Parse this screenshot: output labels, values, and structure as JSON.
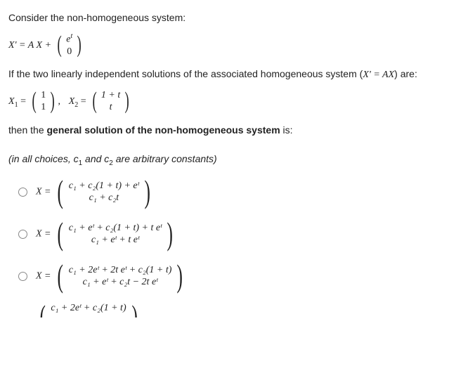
{
  "problem": {
    "intro": "Consider the non-homogeneous system:",
    "system_lhs": "X' = A X +",
    "forcing_top": "e",
    "forcing_top_exp": "t",
    "forcing_bottom": "0",
    "homog_intro_pre": "If the two linearly independent solutions of the associated homogeneous system (",
    "homog_eq": "X' = AX",
    "homog_intro_post": ") are:",
    "x1_label": "X",
    "x1_sub": "1",
    "x1_top": "1",
    "x1_bottom": "1",
    "x2_label": "X",
    "x2_sub": "2",
    "x2_top": "1 + t",
    "x2_bottom": "t",
    "question_pre": "then the ",
    "question_bold": "general solution of the non-homogeneous system",
    "question_post": " is:",
    "note_pre": "(in all choices, c",
    "note_sub1": "1",
    "note_mid": " and c",
    "note_sub2": "2",
    "note_post": " are arbitrary constants)"
  },
  "optA": {
    "top": "c₁ + c₂(1 + t) + eᵗ",
    "bottom": "c₁ + c₂t"
  },
  "optB": {
    "top": "c₁ + eᵗ + c₂(1 + t) + t eᵗ",
    "bottom": "c₁ + eᵗ + t eᵗ"
  },
  "optC": {
    "top": "c₁ + 2eᵗ + 2t eᵗ + c₂(1 + t)",
    "bottom": "c₁ + eᵗ + c₂t − 2t eᵗ"
  },
  "optD": {
    "top": "c₁ + 2eᵗ + c₂(1 + t)"
  },
  "labels": {
    "X_eq": "X ="
  }
}
